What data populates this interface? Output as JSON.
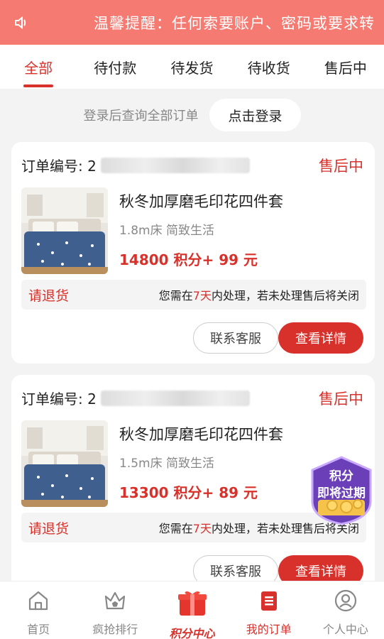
{
  "notice": {
    "icon": "speaker-icon",
    "text": "温馨提醒：任何索要账户、密码或要求转"
  },
  "tabs": [
    {
      "label": "全部",
      "active": true
    },
    {
      "label": "待付款",
      "active": false
    },
    {
      "label": "待发货",
      "active": false
    },
    {
      "label": "待收货",
      "active": false
    },
    {
      "label": "售后中",
      "active": false
    }
  ],
  "login": {
    "hint": "登录后查询全部订单",
    "button": "点击登录"
  },
  "orders": [
    {
      "order_label": "订单编号: 2",
      "status": "售后中",
      "product_name": "秋冬加厚磨毛印花四件套",
      "spec": "1.8m床 简致生活",
      "price": "14800 积分+ 99 元",
      "return_label": "请退货",
      "msg_prefix": "您需在",
      "msg_days": "7天",
      "msg_suffix": "内处理，若未处理售后将关闭",
      "btn_service": "联系客服",
      "btn_detail": "查看详情"
    },
    {
      "order_label": "订单编号: 2",
      "status": "售后中",
      "product_name": "秋冬加厚磨毛印花四件套",
      "spec": "1.5m床 简致生活",
      "price": "13300 积分+ 89 元",
      "return_label": "请退货",
      "msg_prefix": "您需在",
      "msg_days": "7天",
      "msg_suffix": "内处理，若未处理售后将关闭",
      "btn_service": "联系客服",
      "btn_detail": "查看详情"
    }
  ],
  "float_badge": {
    "line1": "积分",
    "line2": "即将过期"
  },
  "bottom_nav": [
    {
      "label": "首页",
      "icon": "home-icon"
    },
    {
      "label": "疯抢排行",
      "icon": "crown-icon"
    },
    {
      "label": "积分中心",
      "icon": "gift-icon"
    },
    {
      "label": "我的订单",
      "icon": "order-icon"
    },
    {
      "label": "个人中心",
      "icon": "user-icon"
    }
  ],
  "colors": {
    "accent": "#d8302a",
    "notice_bg": "#f47a72"
  }
}
